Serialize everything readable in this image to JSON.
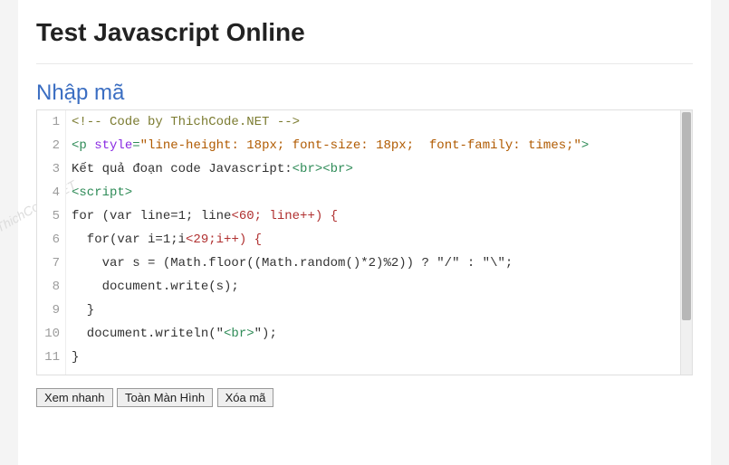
{
  "watermark_text": "ThichCode.NET",
  "header": {
    "title": "Test Javascript Online"
  },
  "section": {
    "title": "Nhập mã"
  },
  "code": {
    "lines": [
      [
        {
          "cls": "tok-comment",
          "t": "<!-- Code by ThichCode.NET -->"
        }
      ],
      [
        {
          "cls": "tok-tag",
          "t": "<p "
        },
        {
          "cls": "tok-attr",
          "t": "style"
        },
        {
          "cls": "tok-tag",
          "t": "="
        },
        {
          "cls": "tok-string",
          "t": "\"line-height: 18px; font-size: 18px;  font-family: times;\""
        },
        {
          "cls": "tok-tag",
          "t": ">"
        }
      ],
      [
        {
          "cls": "tok-plain",
          "t": "Kết quả đoạn code Javascript:"
        },
        {
          "cls": "tok-tag",
          "t": "<br><br>"
        }
      ],
      [
        {
          "cls": "tok-tag",
          "t": "<script>"
        }
      ],
      [
        {
          "cls": "tok-plain",
          "t": "for (var line=1; line"
        },
        {
          "cls": "tok-number",
          "t": "<60; line++) {"
        }
      ],
      [
        {
          "cls": "tok-plain",
          "t": "  for(var i=1;i"
        },
        {
          "cls": "tok-number",
          "t": "<29;i++) {"
        }
      ],
      [
        {
          "cls": "tok-plain",
          "t": "    var s = (Math.floor((Math.random()*2)%2)) ? \"/\" : \"\\\";"
        }
      ],
      [
        {
          "cls": "tok-plain",
          "t": "    document.write(s);"
        }
      ],
      [
        {
          "cls": "tok-plain",
          "t": "  }"
        }
      ],
      [
        {
          "cls": "tok-plain",
          "t": "  document.writeln(\""
        },
        {
          "cls": "tok-tag",
          "t": "<br>"
        },
        {
          "cls": "tok-plain",
          "t": "\");"
        }
      ],
      [
        {
          "cls": "tok-plain",
          "t": "}"
        }
      ]
    ]
  },
  "buttons": {
    "preview": "Xem nhanh",
    "fullscreen": "Toàn Màn Hình",
    "clear": "Xóa mã"
  }
}
